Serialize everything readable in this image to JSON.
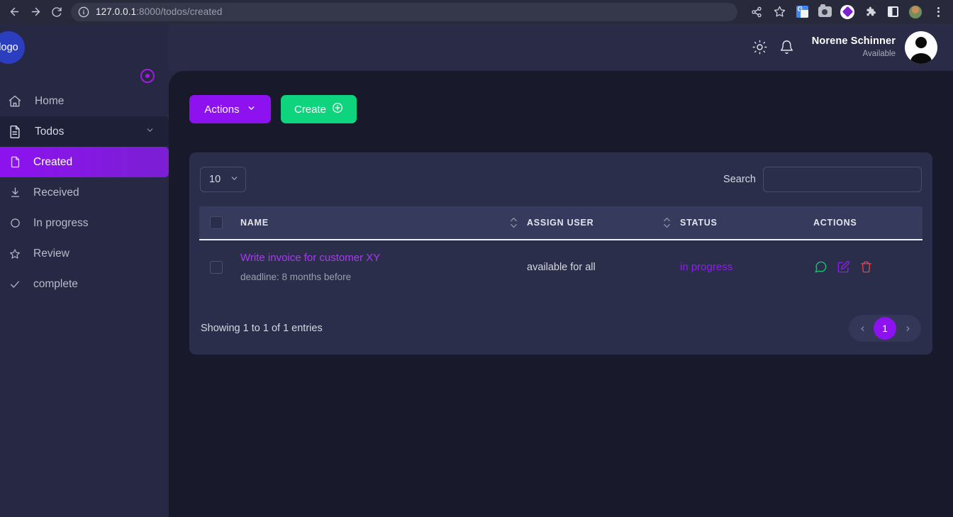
{
  "browser": {
    "url_host": "127.0.0.1",
    "url_path": ":8000/todos/created",
    "back_icon": "back-arrow-icon",
    "forward_icon": "forward-arrow-icon",
    "reload_icon": "reload-icon",
    "info_icon": "site-info-icon",
    "share_icon": "share-icon",
    "bookmark_icon": "star-bookmark-icon",
    "ext_translate": "google-translate-extension-icon",
    "ext_camera": "screenshot-extension-icon",
    "ext_purple": "purple-diamond-extension-icon",
    "ext_puzzle": "extensions-puzzle-icon",
    "ext_square": "split-square-extension-icon",
    "profile_icon": "chrome-profile-avatar",
    "menu_icon": "chrome-menu-icon"
  },
  "header": {
    "theme_icon": "sun-icon",
    "bell_icon": "notification-bell-icon",
    "user_name": "Norene Schinner",
    "user_status": "Available",
    "avatar_icon": "user-avatar"
  },
  "sidebar": {
    "logo_text": "logo",
    "collapse_icon": "collapse-sidebar-icon",
    "items": [
      {
        "label": "Home",
        "icon": "home-icon"
      },
      {
        "label": "Todos",
        "icon": "document-icon",
        "chevron": "chevron-down-icon"
      },
      {
        "label": "Created",
        "icon": "file-icon"
      },
      {
        "label": "Received",
        "icon": "download-icon"
      },
      {
        "label": "In progress",
        "icon": "circle-icon"
      },
      {
        "label": "Review",
        "icon": "star-icon"
      },
      {
        "label": "complete",
        "icon": "check-icon"
      }
    ]
  },
  "toolbar": {
    "actions_label": "Actions",
    "actions_icon": "chevron-down-icon",
    "create_label": "Create",
    "create_icon": "plus-circle-icon"
  },
  "table": {
    "page_length": "10",
    "page_length_icon": "chevron-down-icon",
    "search_label": "Search",
    "search_value": "",
    "search_placeholder": "",
    "columns": {
      "name": "NAME",
      "assign_user": "ASSIGN USER",
      "status": "STATUS",
      "actions": "ACTIONS"
    },
    "rows": [
      {
        "name": "Write invoice for customer XY",
        "deadline": "deadline: 8 months before",
        "assign_user": "available for all",
        "status": "in progress",
        "action_icons": [
          "comment-icon",
          "edit-icon",
          "delete-icon"
        ]
      }
    ],
    "showing_text": "Showing 1 to 1 of 1 entries",
    "pagination": {
      "prev_icon": "chevron-left-icon",
      "next_icon": "chevron-right-icon",
      "current_page": "1"
    }
  },
  "colors": {
    "accent_purple": "#8d12ef",
    "accent_green": "#0ed47d",
    "status_purple": "#8b1fe8",
    "task_link": "#a83bee",
    "delete_red": "#e8434a",
    "comment_green": "#12c96f",
    "sidebar_bg": "#262844",
    "main_bg": "#181a2c",
    "card_bg": "#2b2e4a"
  }
}
